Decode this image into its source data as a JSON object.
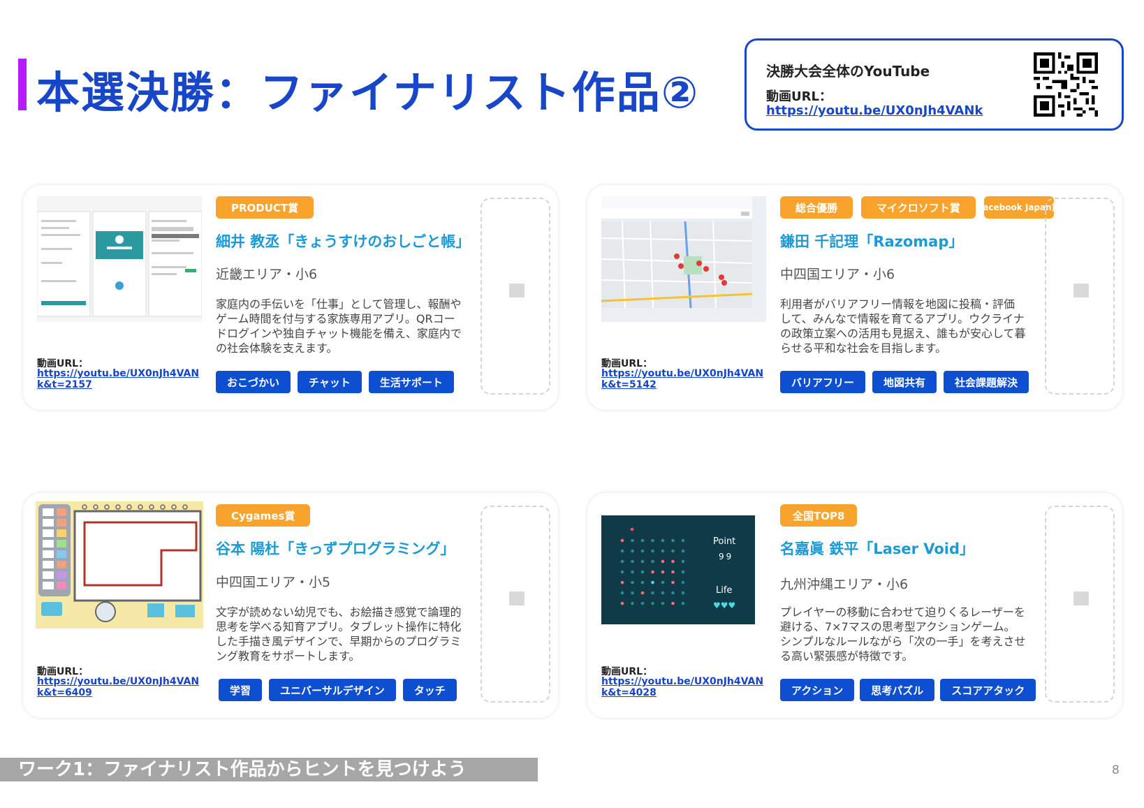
{
  "slide": {
    "title": "本選決勝：ファイナリスト作品②",
    "footer": "ワーク1：ファイナリスト作品からヒントを見つけよう",
    "page_number": "8"
  },
  "youtube": {
    "title": "決勝大会全体のYouTube",
    "url_label": "動画URL：",
    "url": "https://youtu.be/UX0nJh4VANk"
  },
  "colors": {
    "accent": "#1846c9",
    "badge": "#f7a32c",
    "tag": "#0d4fd0",
    "name": "#1c9ad6",
    "title_bar": "#b61cff"
  },
  "cards": [
    {
      "badges": [
        "PRODUCT賞"
      ],
      "name": "細井 教丞「きょうすけのおしごと帳」",
      "area": "近畿エリア・小6",
      "description": "家庭内の手伝いを「仕事」として管理し、報酬やゲーム時間を付与する家族専用アプリ。QRコードログインや独自チャット機能を備え、家庭内での社会体験を支えます。",
      "url_label": "動画URL：",
      "url": "https://youtu.be/UX0nJh4VANk&t=2157",
      "tags": [
        "おこづかい",
        "チャット",
        "生活サポート"
      ]
    },
    {
      "badges": [
        "総合優勝",
        "マイクロソフト賞",
        "Facebook Japan賞"
      ],
      "name": "鎌田 千記理「Razomap」",
      "area": "中四国エリア・小6",
      "description": "利用者がバリアフリー情報を地図に投稿・評価して、みんなで情報を育てるアプリ。ウクライナの政策立案への活用も見据え、誰もが安心して暮らせる平和な社会を目指します。",
      "url_label": "動画URL：",
      "url": "https://youtu.be/UX0nJh4VANk&t=5142",
      "tags": [
        "バリアフリー",
        "地図共有",
        "社会課題解決"
      ]
    },
    {
      "badges": [
        "Cygames賞"
      ],
      "name": "谷本 陽杜「きっずプログラミング」",
      "area": "中四国エリア・小5",
      "description": "文字が読めない幼児でも、お絵描き感覚で論理的思考を学べる知育アプリ。タブレット操作に特化した手描き風デザインで、早期からのプログラミング教育をサポートします。",
      "url_label": "動画URL：",
      "url": "https://youtu.be/UX0nJh4VANk&t=6409",
      "tags": [
        "学習",
        "ユニバーサルデザイン",
        "タッチ"
      ]
    },
    {
      "badges": [
        "全国TOP8"
      ],
      "name": "名嘉眞 鉄平「Laser Void」",
      "area": "九州沖縄エリア・小6",
      "description": "プレイヤーの移動に合わせて迫りくるレーザーを避ける、7×7マスの思考型アクションゲーム。シンプルなルールながら「次の一手」を考えさせる高い緊張感が特徴です。",
      "url_label": "動画URL：",
      "url": "https://youtu.be/UX0nJh4VANk&t=4028",
      "tags": [
        "アクション",
        "思考パズル",
        "スコアアタック"
      ],
      "game": {
        "point_label": "Point",
        "point_value": "99",
        "life_label": "Life",
        "life_value": "♥♥♥"
      }
    }
  ]
}
